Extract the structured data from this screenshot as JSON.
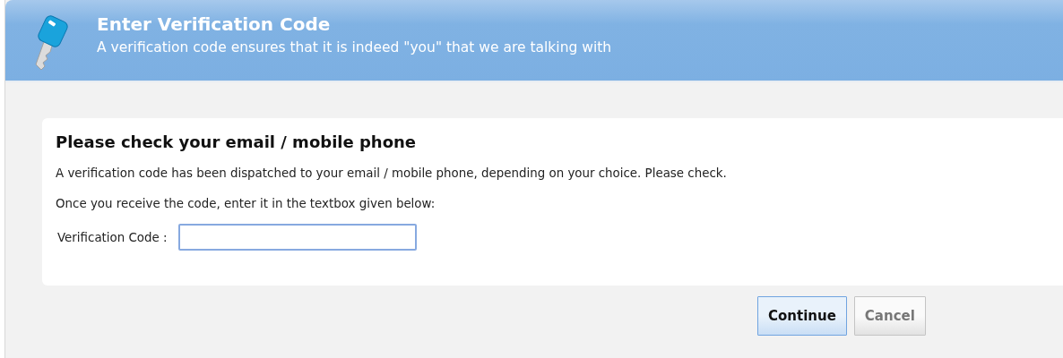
{
  "header": {
    "title": "Enter Verification Code",
    "subtitle": "A verification code ensures that it is indeed \"you\" that we are talking with"
  },
  "card": {
    "heading": "Please check your email / mobile phone",
    "paragraphs": [
      "A verification code has been dispatched to your email / mobile phone, depending on your choice. Please check.",
      "Once you receive the code, enter it in the textbox given below:"
    ],
    "field": {
      "label": "Verification Code :",
      "focused": true
    }
  },
  "buttons": [
    {
      "label": "Continue",
      "kind": "primary"
    },
    {
      "label": "Cancel",
      "kind": "secondary"
    }
  ]
}
